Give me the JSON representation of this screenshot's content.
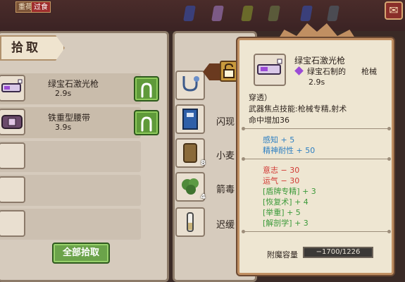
{
  "top": {
    "tag_left": "重荷",
    "tag_right": "过食",
    "right_icon": "notification-icon"
  },
  "pickup": {
    "header": "拾取",
    "items": [
      {
        "name": "绿宝石激光枪",
        "time": "2.9s",
        "icon": "laser-gun-icon"
      },
      {
        "name": "铁重型腰带",
        "time": "3.9s",
        "icon": "belt-icon"
      }
    ],
    "all_button": "全部拾取"
  },
  "inventory": {
    "items": [
      {
        "name": "",
        "icon": "stethoscope-icon",
        "count": ""
      },
      {
        "name": "闪现",
        "icon": "book-icon",
        "count": ""
      },
      {
        "name": "小麦",
        "icon": "wheat-sack-icon",
        "count": "8"
      },
      {
        "name": "箭毒",
        "icon": "herb-icon",
        "count": "4"
      },
      {
        "name": "迟缓",
        "icon": "potion-vial-icon",
        "count": ""
      }
    ]
  },
  "tooltip": {
    "title": "绿宝石激光枪",
    "subtitle": "绿宝石制的",
    "category": "枪械",
    "time": "2.9s",
    "desc_line1": "穿透）",
    "desc_line2": "武器焦点技能:枪械专精,射术",
    "desc_line3": "命中增加36",
    "stats_blue": [
      "感知 + 5",
      "精神耐性 + 50"
    ],
    "stats_red": [
      "意志 − 30",
      "运气 − 30"
    ],
    "stats_green": [
      "[盾牌专精] + 3",
      "[恢复术] + 4",
      "[举重] + 5",
      "[解剖学] + 3"
    ],
    "enchant_label": "附魔容量",
    "enchant_value": "−1700/1226"
  },
  "colors": {
    "panel_bg": "#d6cbbd",
    "tooltip_bg": "#eee6d2",
    "green_button": "#5f9a3a",
    "stat_blue": "#2d7fc2",
    "stat_red": "#d13a35",
    "stat_green": "#3c9a3a"
  }
}
